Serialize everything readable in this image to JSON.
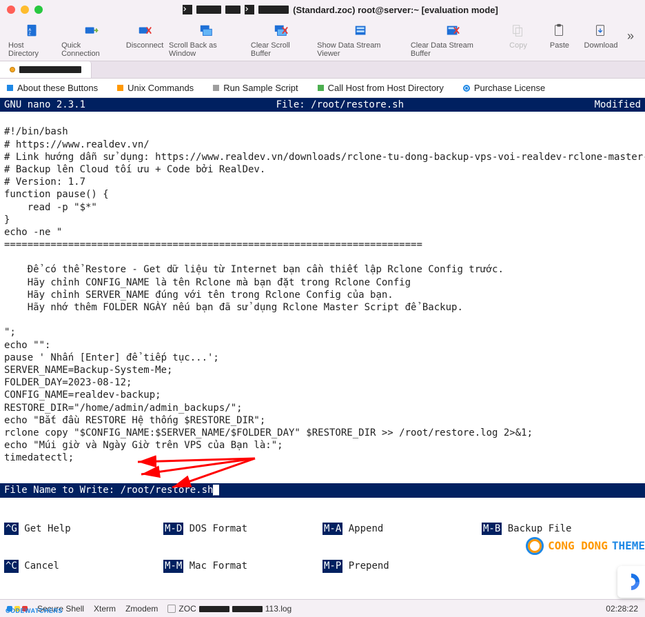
{
  "window": {
    "title_suffix": "(Standard.zoc) root@server:~ [evaluation mode]"
  },
  "toolbar": {
    "host_directory": "Host Directory",
    "quick_connection": "Quick Connection",
    "disconnect": "Disconnect",
    "scroll_back": "Scroll Back as Window",
    "clear_scroll": "Clear Scroll Buffer",
    "show_data": "Show Data Stream Viewer",
    "clear_data": "Clear Data Stream Buffer",
    "copy": "Copy",
    "paste": "Paste",
    "download": "Download"
  },
  "linkbar": {
    "about": "About these Buttons",
    "unix": "Unix Commands",
    "sample": "Run Sample Script",
    "callhost": "Call Host from Host Directory",
    "purchase": "Purchase License"
  },
  "nano": {
    "version": "GNU nano 2.3.1",
    "file_label": "File: /root/restore.sh",
    "status": "Modified",
    "body": "\n#!/bin/bash\n# https://www.realdev.vn/\n# Link hướng dẫn sử dụng: https://www.realdev.vn/downloads/rclone-tu-dong-backup-vps-voi-realdev-rclone-master-scr$\n# Backup lên Cloud tối ưu + Code bởi RealDev.\n# Version: 1.7\nfunction pause() {\n    read -p \"$*\"\n}\necho -ne \"\n========================================================================\n\n    Để có thể Restore - Get dữ liệu từ Internet bạn cần thiết lập Rclone Config trước.\n    Hãy chỉnh CONFIG_NAME là tên Rclone mà bạn đặt trong Rclone Config\n    Hãy chỉnh SERVER_NAME đúng với tên trong Rclone Config của bạn.\n    Hãy nhớ thêm FOLDER NGÀY nếu bạn đã sử dụng Rclone Master Script để Backup.\n\n\";\necho \"\":\npause ' Nhấn [Enter] để tiếp tục...';\nSERVER_NAME=Backup-System-Me;\nFOLDER_DAY=2023-08-12;\nCONFIG_NAME=realdev-backup;\nRESTORE_DIR=\"/home/admin/admin_backups/\";\necho \"Bắt đầu RESTORE Hệ thống $RESTORE_DIR\";\nrclone copy \"$CONFIG_NAME:$SERVER_NAME/$FOLDER_DAY\" $RESTORE_DIR >> /root/restore.log 2>&1;\necho \"Múi giờ và Ngày Giờ trên VPS của Bạn là:\";\ntimedatectl;",
    "prompt": "File Name to Write: /root/restore.sh",
    "keys": {
      "r1c1": "Get Help",
      "r1c2": "DOS Format",
      "r1c3": "Append",
      "r1c4": "Backup File",
      "r2c1": "Cancel",
      "r2c2": "Mac Format",
      "r2c3": "Prepend",
      "k1c1": "^G",
      "k1c2": "M-D",
      "k1c3": "M-A",
      "k1c4": "M-B",
      "k2c1": "^C",
      "k2c2": "M-M",
      "k2c3": "M-P"
    }
  },
  "statusbar": {
    "shell": "Secure Shell",
    "xterm": "Xterm",
    "zmodem": "Zmodem",
    "zoc": "ZOC",
    "log": "113.log",
    "time": "02:28:22"
  },
  "watermark": {
    "t1": "CONG DONG",
    "t2": "THEME"
  }
}
